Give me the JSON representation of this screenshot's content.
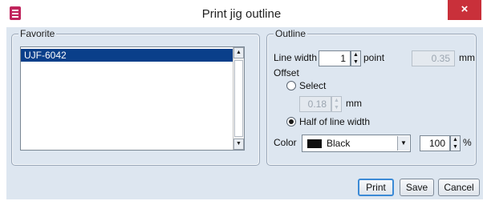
{
  "window": {
    "title": "Print jig outline",
    "close_glyph": "×"
  },
  "favorite": {
    "group_title": "Favorite",
    "items": [
      "UJF-6042"
    ],
    "selected_index": 0
  },
  "outline": {
    "group_title": "Outline",
    "line_width_label": "Line width",
    "line_width_value": "1",
    "line_width_unit": "point",
    "line_width_mm_value": "0.35",
    "line_width_mm_unit": "mm",
    "offset_label": "Offset",
    "offset_select_label": "Select",
    "offset_select_value": "0.18",
    "offset_select_unit": "mm",
    "offset_half_label": "Half of line width",
    "offset_selected": "half",
    "color_label": "Color",
    "color_value": "Black",
    "color_swatch": "#111111",
    "color_percent_value": "100",
    "color_percent_unit": "%"
  },
  "buttons": {
    "print": "Print",
    "save": "Save",
    "cancel": "Cancel"
  },
  "icons": {
    "scroll_up": "▲",
    "scroll_down": "▼",
    "spin_up": "▲",
    "spin_down": "▼",
    "combo_arrow": "▼"
  }
}
